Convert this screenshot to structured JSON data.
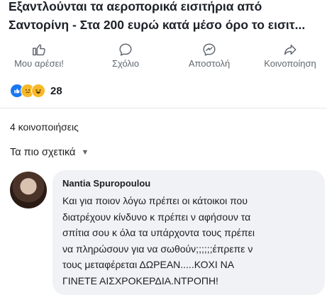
{
  "post": {
    "headline_lines": [
      "Εξαντλούνται τα αεροπορικά εισιτήρια από",
      "Σαντορίνη - Στα 200 ευρώ κατά μέσο όρο το εισιτ..."
    ]
  },
  "actions": [
    {
      "label": "Μου αρέσει!",
      "icon": "like-icon"
    },
    {
      "label": "Σχόλιο",
      "icon": "comment-icon"
    },
    {
      "label": "Αποστολή",
      "icon": "messenger-icon"
    },
    {
      "label": "Κοινοποίηση",
      "icon": "share-icon"
    }
  ],
  "reactions": {
    "icons": [
      "like-reaction-icon",
      "sad-reaction-icon",
      "haha-reaction-icon"
    ],
    "count": "28"
  },
  "shares": "4 κοινοποιήσεις",
  "sort": {
    "label": "Τα πιο σχετικά",
    "icon": "chevron-down-icon"
  },
  "comment": {
    "author": "Nantia Spuropoulou",
    "lines": [
      "Και για ποιον λόγω πρέπει οι κάτοικοι που",
      "διατρέχουν κίνδυνο κ πρέπει ν αφήσουν τα",
      "σπίτια σου κ όλα τα υπάρχοντα τους πρέπει",
      "να πληρώσουν για να σωθούν;;;;;;έπρεπε ν",
      "τους μεταφέρεται ΔΩΡΕΑΝ.....ΚΟΧΙ ΝΑ",
      "ΓΙΝΕΤΕ ΑΙΣΧΡΟΚΕΡΔΙΑ.ΝΤΡΟΠΗ!"
    ]
  },
  "colors": {
    "like_blue": "#1877f2",
    "reaction_yellow": "#f7b928",
    "secondary_text": "#606770",
    "bubble_bg": "#f0f2f5"
  }
}
